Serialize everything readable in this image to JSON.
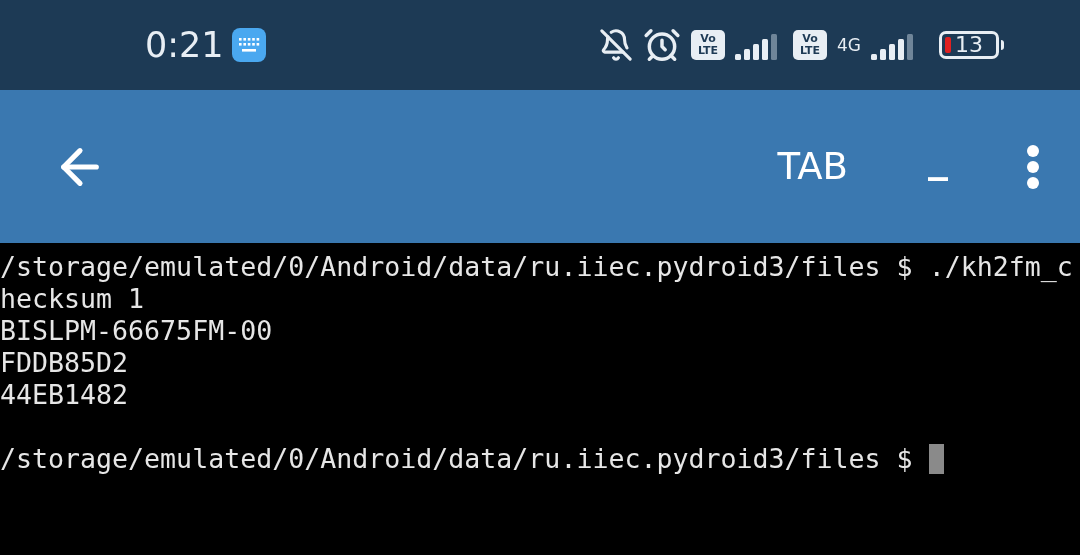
{
  "status_bar": {
    "time": "0:21",
    "volte_badges": [
      {
        "top": "Vo",
        "bottom": "LTE"
      },
      {
        "top": "Vo",
        "bottom": "LTE"
      }
    ],
    "network_type": "4G",
    "battery": "13"
  },
  "toolbar": {
    "buttons": [
      {
        "label": "TAB"
      },
      {
        "label": "_"
      }
    ]
  },
  "terminal": {
    "lines": [
      {
        "kind": "text",
        "text": "/storage/emulated/0/Android/data/ru.iiec.pydroid3/files $ ./kh2fm_c"
      },
      {
        "kind": "text",
        "text": "hecksum 1"
      },
      {
        "kind": "text",
        "text": "BISLPM-66675FM-00"
      },
      {
        "kind": "text",
        "text": "FDDB85D2"
      },
      {
        "kind": "text",
        "text": "44EB1482"
      },
      {
        "kind": "blank"
      },
      {
        "kind": "text",
        "text": "/storage/emulated/0/Android/data/ru.iiec.pydroid3/files $ "
      }
    ],
    "cursor": true
  }
}
